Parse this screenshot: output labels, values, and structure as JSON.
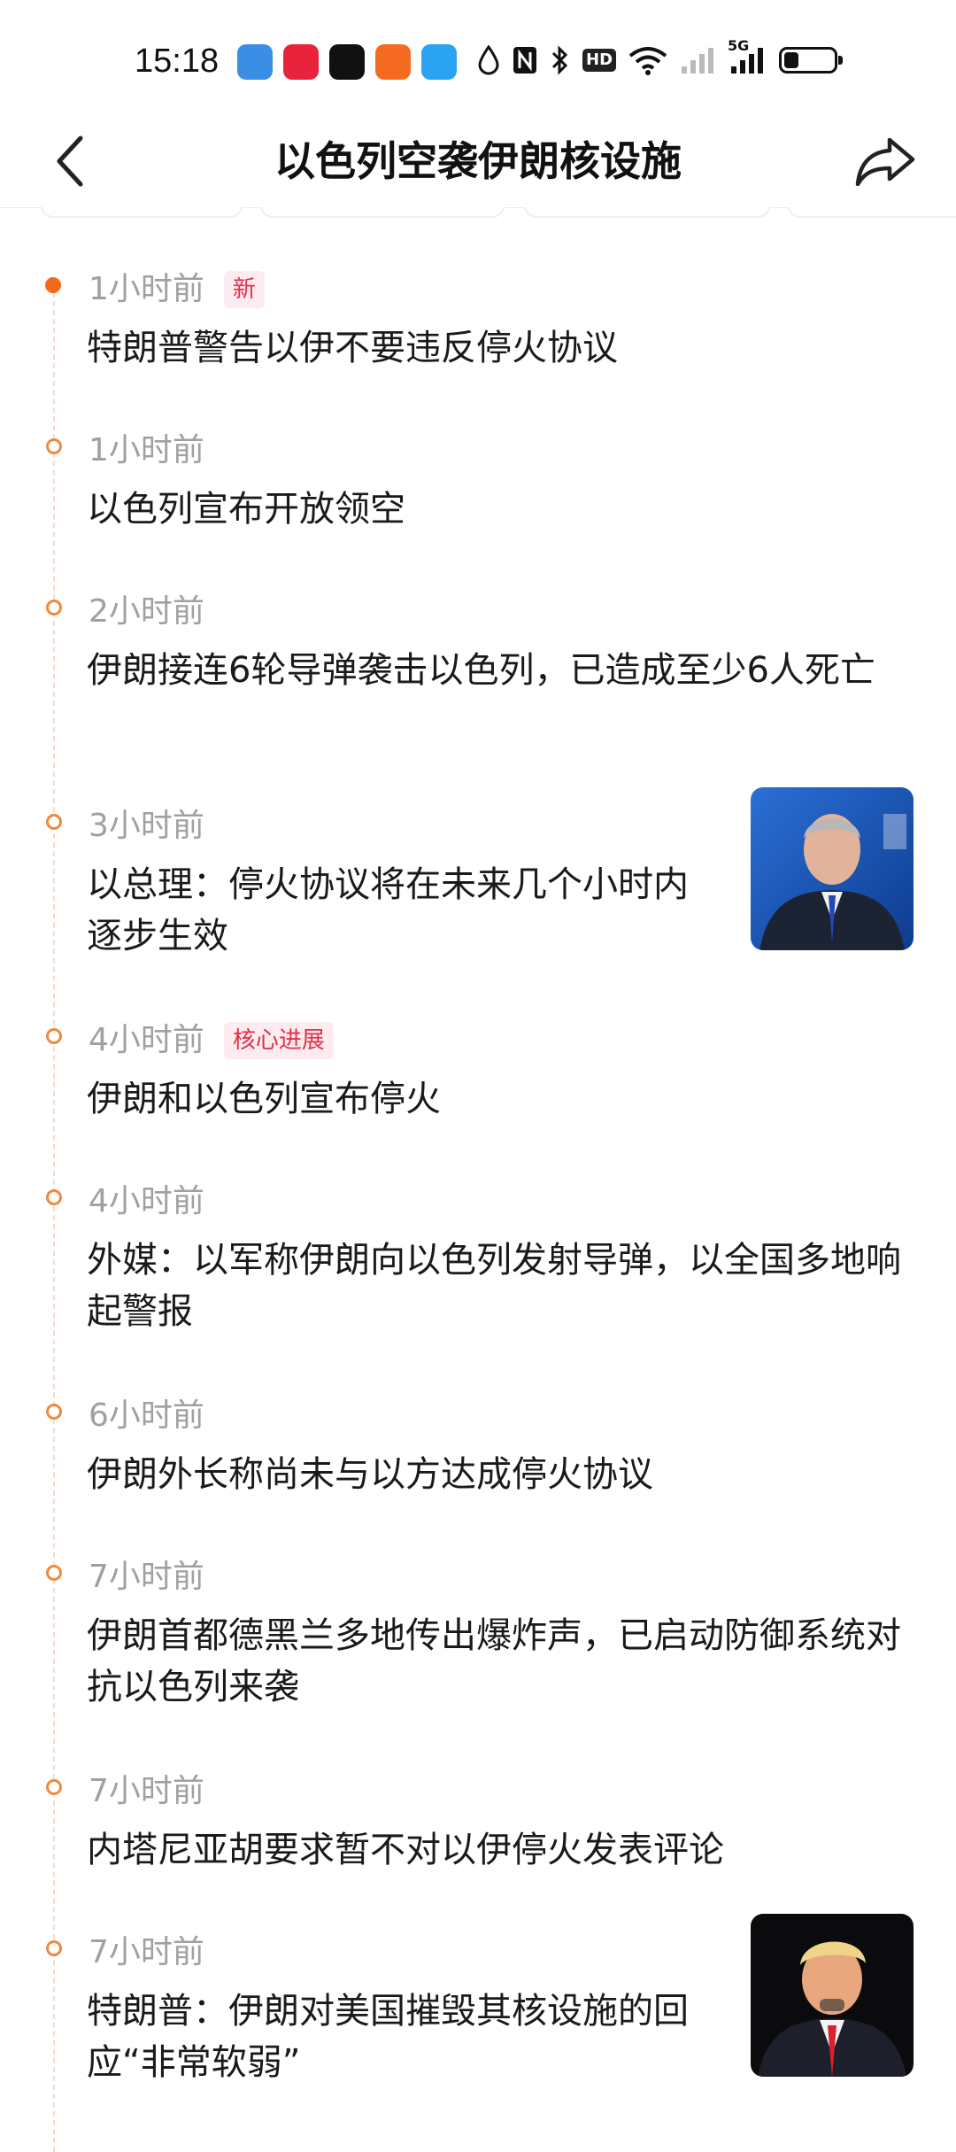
{
  "status_bar": {
    "time": "15:18",
    "hd_label": "HD",
    "network_label": "5G",
    "battery_level": 0.3
  },
  "header": {
    "title": "以色列空袭伊朗核设施"
  },
  "timeline": [
    {
      "time": "1小时前",
      "tag": "新",
      "headline": "特朗普警告以伊不要违反停火协议",
      "has_image": false
    },
    {
      "time": "1小时前",
      "tag": "",
      "headline": "以色列宣布开放领空",
      "has_image": false
    },
    {
      "time": "2小时前",
      "tag": "",
      "headline": "伊朗接连6轮导弹袭击以色列，已造成至少6人死亡",
      "has_image": false
    },
    {
      "time": "3小时前",
      "tag": "",
      "headline": "以总理：停火协议将在未来几个小时内逐步生效",
      "has_image": true,
      "image_icon": "person-photo-icon"
    },
    {
      "time": "4小时前",
      "tag": "核心进展",
      "headline": "伊朗和以色列宣布停火",
      "has_image": false
    },
    {
      "time": "4小时前",
      "tag": "",
      "headline": "外媒：以军称伊朗向以色列发射导弹，以全国多地响起警报",
      "has_image": false
    },
    {
      "time": "6小时前",
      "tag": "",
      "headline": "伊朗外长称尚未与以方达成停火协议",
      "has_image": false
    },
    {
      "time": "7小时前",
      "tag": "",
      "headline": "伊朗首都德黑兰多地传出爆炸声，已启动防御系统对抗以色列来袭",
      "has_image": false
    },
    {
      "time": "7小时前",
      "tag": "",
      "headline": "内塔尼亚胡要求暂不对以伊停火发表评论",
      "has_image": false
    },
    {
      "time": "7小时前",
      "tag": "",
      "headline": "特朗普：伊朗对美国摧毁其核设施的回应“非常软弱”",
      "has_image": true,
      "image_icon": "person-photo-icon"
    }
  ]
}
